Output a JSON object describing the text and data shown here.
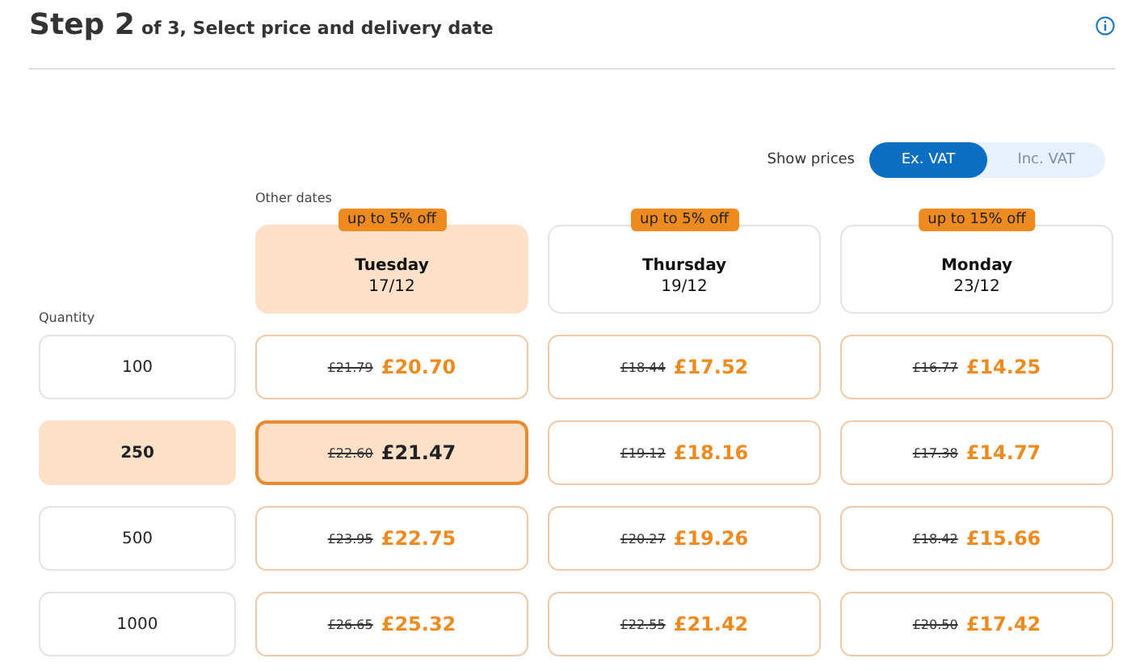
{
  "header": {
    "step": "Step 2",
    "subtitle": "of 3, Select price and delivery date"
  },
  "vat_toggle": {
    "label": "Show prices",
    "options": [
      {
        "label": "Ex. VAT",
        "selected": true
      },
      {
        "label": "Inc. VAT",
        "selected": false
      }
    ]
  },
  "other_dates_label": "Other dates",
  "quantity_label": "Quantity",
  "dates": [
    {
      "badge": "up to 5% off",
      "day": "Tuesday",
      "date": "17/12",
      "selected": true
    },
    {
      "badge": "up to 5% off",
      "day": "Thursday",
      "date": "19/12",
      "selected": false
    },
    {
      "badge": "up to 15% off",
      "day": "Monday",
      "date": "23/12",
      "selected": false
    }
  ],
  "rows": [
    {
      "quantity": "100",
      "selected": false,
      "prices": [
        {
          "old": "£21.79",
          "new": "£20.70",
          "selected": false
        },
        {
          "old": "£18.44",
          "new": "£17.52",
          "selected": false
        },
        {
          "old": "£16.77",
          "new": "£14.25",
          "selected": false
        }
      ]
    },
    {
      "quantity": "250",
      "selected": true,
      "prices": [
        {
          "old": "£22.60",
          "new": "£21.47",
          "selected": true
        },
        {
          "old": "£19.12",
          "new": "£18.16",
          "selected": false
        },
        {
          "old": "£17.38",
          "new": "£14.77",
          "selected": false
        }
      ]
    },
    {
      "quantity": "500",
      "selected": false,
      "prices": [
        {
          "old": "£23.95",
          "new": "£22.75",
          "selected": false
        },
        {
          "old": "£20.27",
          "new": "£19.26",
          "selected": false
        },
        {
          "old": "£18.42",
          "new": "£15.66",
          "selected": false
        }
      ]
    },
    {
      "quantity": "1000",
      "selected": false,
      "prices": [
        {
          "old": "£26.65",
          "new": "£25.32",
          "selected": false
        },
        {
          "old": "£22.55",
          "new": "£21.42",
          "selected": false
        },
        {
          "old": "£20.50",
          "new": "£17.42",
          "selected": false
        }
      ]
    }
  ]
}
